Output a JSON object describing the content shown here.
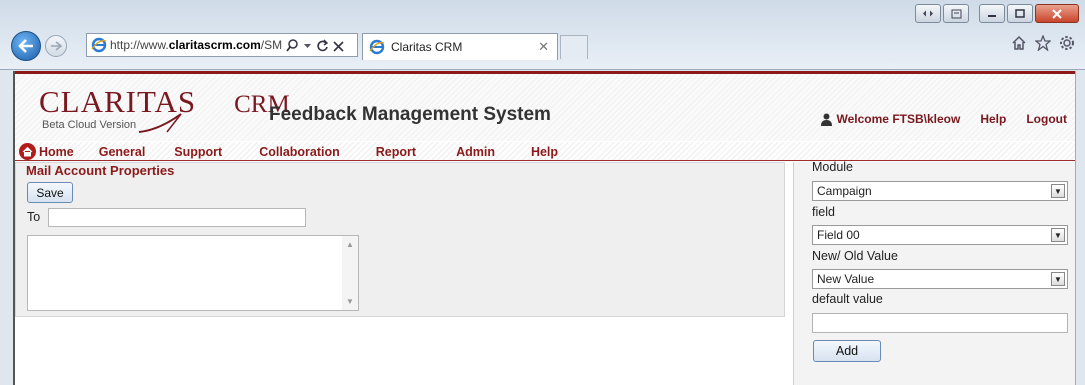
{
  "browser": {
    "url_prefix": "http://www.",
    "url_domain": "claritascrm.com",
    "url_suffix": "/SM",
    "tab_title": "Claritas CRM"
  },
  "brand": {
    "logo_text": "CLARITAS",
    "logo_crm": "CRM",
    "logo_sub": "Beta Cloud Version",
    "system_title": "Feedback Management System"
  },
  "user": {
    "welcome": "Welcome FTSB\\kleow",
    "help": "Help",
    "logout": "Logout"
  },
  "menu": {
    "home": "Home",
    "general": "General",
    "support": "Support",
    "collaboration": "Collaboration",
    "report": "Report",
    "admin": "Admin",
    "help": "Help"
  },
  "mail": {
    "title": "Mail Account Properties",
    "save": "Save",
    "to_label": "To",
    "to_value": "",
    "body_value": ""
  },
  "side": {
    "module_label": "Module",
    "module_value": "Campaign",
    "field_label": "field",
    "field_value": "Field 00",
    "newold_label": "New/ Old Value",
    "newold_value": "New Value",
    "default_label": "default value",
    "default_value": "",
    "add": "Add"
  },
  "colors": {
    "brand_red": "#8b1a1a",
    "browser_blue": "#1a5ea8"
  }
}
